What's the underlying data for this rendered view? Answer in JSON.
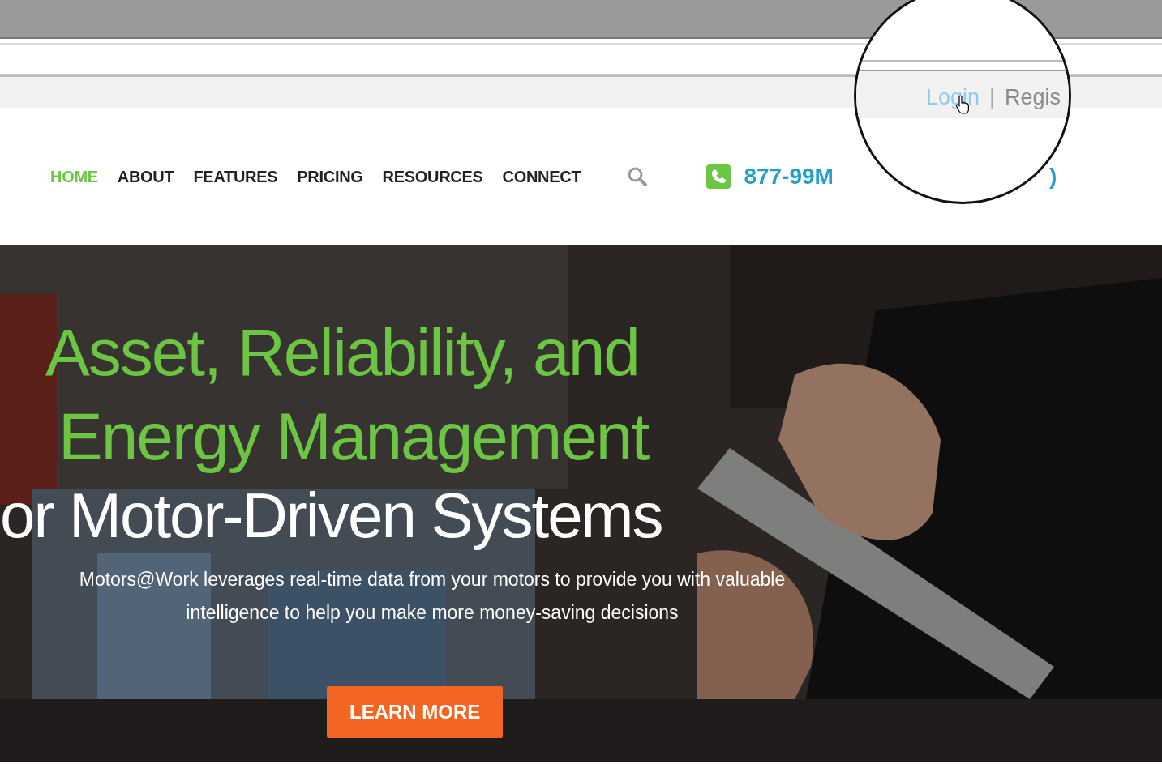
{
  "magnifier": {
    "links": [
      {
        "label": "Login"
      },
      {
        "label": "Regis"
      }
    ],
    "separator": "|"
  },
  "nav": {
    "items": [
      {
        "label": "HOME",
        "selected": true
      },
      {
        "label": "ABOUT",
        "selected": false
      },
      {
        "label": "FEATURES",
        "selected": false
      },
      {
        "label": "PRICING",
        "selected": false
      },
      {
        "label": "RESOURCES",
        "selected": false
      },
      {
        "label": "CONNECT",
        "selected": false
      }
    ]
  },
  "phone": {
    "number": "877-99M",
    "fragment": ")"
  },
  "hero": {
    "heading": [
      "Asset, Reliability, and",
      "Energy Management"
    ],
    "subheading": "or Motor-Driven Systems",
    "text": "Motors@Work leverages real-time data from your motors to provide you with valuable intelligence to help you make more money-saving decisions",
    "button": "LEARN MORE"
  }
}
